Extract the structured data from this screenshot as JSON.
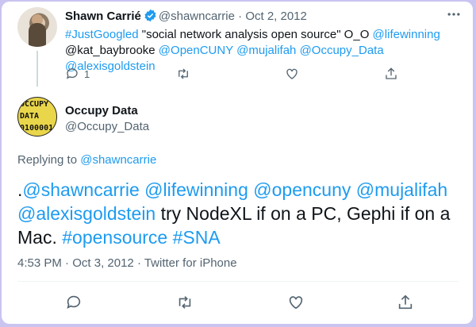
{
  "parent_tweet": {
    "author_name": "Shawn Carrié",
    "handle": "@shawncarrie",
    "separator": " · ",
    "date": "Oct 2, 2012",
    "text_parts": {
      "hashtag": "#JustGoogled",
      "quote": " \"social network analysis open source\" O_O ",
      "mention_lifewinning": "@lifewinning",
      "plain_kat": "@kat_baybrooke ",
      "mention_opencuny": "@OpenCUNY",
      "mention_mujalifah": "@mujalifah",
      "mention_occupydata": "@Occupy_Data",
      "mention_alexisgoldstein": "@alexisgoldstein"
    },
    "reply_count": "1",
    "icons": [
      "reply-icon",
      "retweet-icon",
      "like-icon",
      "share-icon",
      "more-icon",
      "verified-icon"
    ]
  },
  "main_tweet": {
    "author_name": "Occupy Data",
    "handle": "@Occupy_Data",
    "avatar_text": [
      "OCCUPY",
      "DATA",
      "0100001"
    ],
    "replying_to_label": "Replying to ",
    "replying_to_handle": "@shawncarrie",
    "text_parts": {
      "lead": ".",
      "m1": "@shawncarrie",
      "m2": "@lifewinning",
      "m3": "@opencuny",
      "m4": "@mujalifah",
      "m5": "@alexisgoldstein",
      "body": " try NodeXL if on a PC, Gephi if on a Mac. ",
      "h1": "#opensource",
      "h2": "#SNA"
    },
    "time": "4:53 PM",
    "date": "Oct 3, 2012",
    "source": "Twitter for iPhone",
    "icons": [
      "reply-icon",
      "retweet-icon",
      "like-icon",
      "share-icon"
    ]
  },
  "colors": {
    "link": "#1d9bf0",
    "muted": "#536471",
    "frame_border": "#c9c4f0"
  }
}
